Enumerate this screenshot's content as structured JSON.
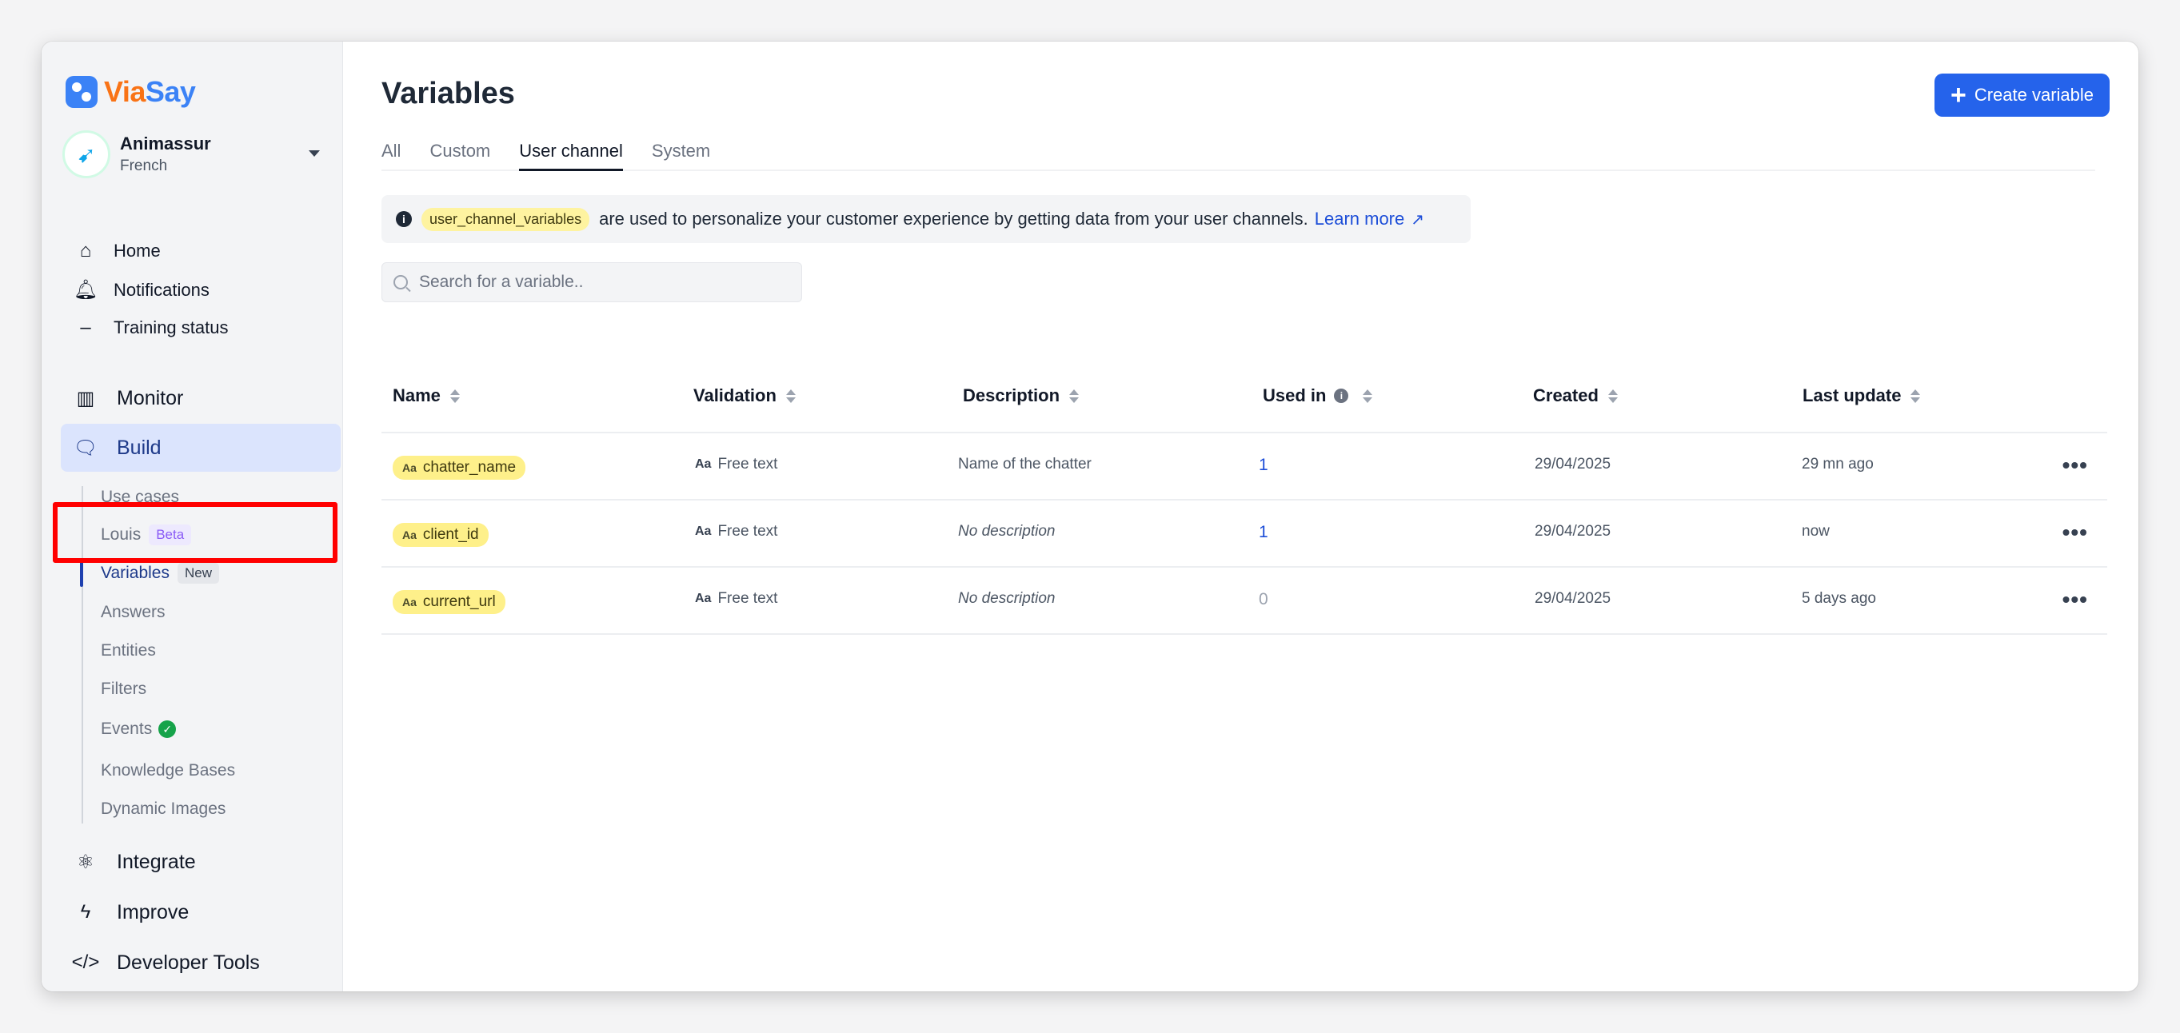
{
  "brand": {
    "via": "Via",
    "say": "Say"
  },
  "account": {
    "name": "Animassur",
    "language": "French"
  },
  "nav_top": [
    {
      "label": "Home",
      "icon": "home-icon"
    },
    {
      "label": "Notifications",
      "icon": "bell-icon"
    },
    {
      "label": "Training status",
      "icon": "minus-icon"
    }
  ],
  "nav_main": {
    "monitor": "Monitor",
    "build": "Build",
    "integrate": "Integrate",
    "improve": "Improve",
    "developer_tools": "Developer Tools"
  },
  "build_sub": {
    "use_cases": "Use cases",
    "louis": "Louis",
    "louis_badge": "Beta",
    "variables": "Variables",
    "variables_badge": "New",
    "answers": "Answers",
    "entities": "Entities",
    "filters": "Filters",
    "events": "Events",
    "knowledge_bases": "Knowledge Bases",
    "dynamic_images": "Dynamic Images"
  },
  "page": {
    "title": "Variables",
    "create_button": "Create variable",
    "tabs": [
      "All",
      "Custom",
      "User channel",
      "System"
    ],
    "active_tab": "User channel"
  },
  "banner": {
    "chip": "user_channel_variables",
    "text": "are used to personalize your customer experience by getting data from your user channels.",
    "link": "Learn more"
  },
  "search": {
    "placeholder": "Search for a variable.."
  },
  "table": {
    "headers": {
      "name": "Name",
      "validation": "Validation",
      "description": "Description",
      "used_in": "Used in",
      "created": "Created",
      "last_update": "Last update"
    },
    "rows": [
      {
        "name": "chatter_name",
        "validation": "Free text",
        "description": "Name of the chatter",
        "used_in": "1",
        "created": "29/04/2025",
        "last_update": "29 mn ago"
      },
      {
        "name": "client_id",
        "validation": "Free text",
        "description": "No description",
        "used_in": "1",
        "created": "29/04/2025",
        "last_update": "now"
      },
      {
        "name": "current_url",
        "validation": "Free text",
        "description": "No description",
        "used_in": "0",
        "created": "29/04/2025",
        "last_update": "5 days ago"
      }
    ],
    "type_prefix": "Aa"
  },
  "colors": {
    "accent": "#2563eb",
    "active_nav_bg": "#dbe4fd",
    "chip_yellow": "#fef08a",
    "highlight": "#ff0000"
  }
}
